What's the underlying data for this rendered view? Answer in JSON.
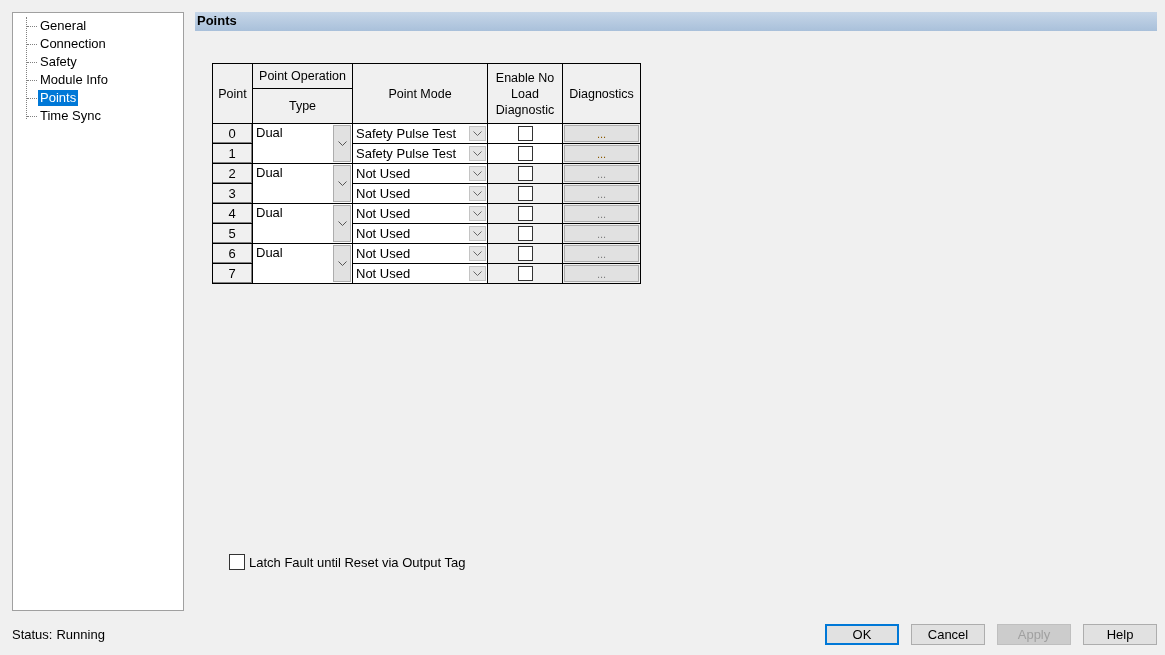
{
  "tree": {
    "items": [
      {
        "label": "General",
        "selected": false
      },
      {
        "label": "Connection",
        "selected": false
      },
      {
        "label": "Safety",
        "selected": false
      },
      {
        "label": "Module Info",
        "selected": false
      },
      {
        "label": "Points",
        "selected": true
      },
      {
        "label": "Time Sync",
        "selected": false
      }
    ]
  },
  "section_title": "Points",
  "table": {
    "headers": {
      "point": "Point",
      "operation": "Point Operation",
      "type": "Type",
      "mode": "Point Mode",
      "enable": "Enable No Load Diagnostic",
      "diagnostics": "Diagnostics"
    },
    "groups": [
      {
        "type": "Dual",
        "points": [
          {
            "point": "0",
            "mode": "Safety Pulse Test",
            "no_load_checked": false,
            "disabled": false,
            "diagnostics": "..."
          },
          {
            "point": "1",
            "mode": "Safety Pulse Test",
            "no_load_checked": false,
            "disabled": false,
            "diagnostics": "..."
          }
        ]
      },
      {
        "type": "Dual",
        "points": [
          {
            "point": "2",
            "mode": "Not Used",
            "no_load_checked": false,
            "disabled": true,
            "diagnostics": "..."
          },
          {
            "point": "3",
            "mode": "Not Used",
            "no_load_checked": false,
            "disabled": true,
            "diagnostics": "..."
          }
        ]
      },
      {
        "type": "Dual",
        "points": [
          {
            "point": "4",
            "mode": "Not Used",
            "no_load_checked": false,
            "disabled": true,
            "diagnostics": "..."
          },
          {
            "point": "5",
            "mode": "Not Used",
            "no_load_checked": false,
            "disabled": true,
            "diagnostics": "..."
          }
        ]
      },
      {
        "type": "Dual",
        "points": [
          {
            "point": "6",
            "mode": "Not Used",
            "no_load_checked": false,
            "disabled": true,
            "diagnostics": "..."
          },
          {
            "point": "7",
            "mode": "Not Used",
            "no_load_checked": false,
            "disabled": true,
            "diagnostics": "..."
          }
        ]
      }
    ]
  },
  "latch": {
    "label": "Latch Fault until Reset via Output Tag",
    "checked": false
  },
  "status": {
    "label": "Status:",
    "value": "Running"
  },
  "buttons": [
    {
      "label": "OK",
      "default": true,
      "disabled": false
    },
    {
      "label": "Cancel",
      "default": false,
      "disabled": false
    },
    {
      "label": "Apply",
      "default": false,
      "disabled": true
    },
    {
      "label": "Help",
      "default": false,
      "disabled": false
    }
  ]
}
